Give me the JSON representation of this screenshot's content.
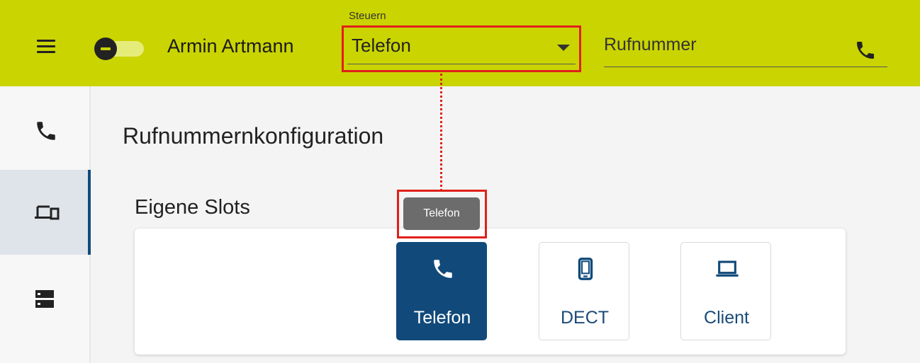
{
  "header": {
    "user_name": "Armin Artmann",
    "control": {
      "label": "Steuern",
      "selected": "Telefon"
    },
    "phone_input": {
      "placeholder": "Rufnummer"
    }
  },
  "sidebar": {
    "items": [
      {
        "name": "phone",
        "icon": "phone-icon",
        "active": false
      },
      {
        "name": "devices",
        "icon": "devices-icon",
        "active": true
      },
      {
        "name": "servers",
        "icon": "server-icon",
        "active": false
      }
    ]
  },
  "main": {
    "title": "Rufnummernkonfiguration",
    "section_title": "Eigene Slots",
    "tooltip": "Telefon",
    "slots": [
      {
        "label": "Telefon",
        "icon": "phone-icon",
        "selected": true
      },
      {
        "label": "DECT",
        "icon": "mobile-phone-icon",
        "selected": false
      },
      {
        "label": "Client",
        "icon": "laptop-icon",
        "selected": false
      }
    ]
  },
  "colors": {
    "header_bg": "#cad400",
    "accent": "#114a7a",
    "highlight": "#e0201b",
    "tooltip_bg": "#6c6c6c"
  }
}
